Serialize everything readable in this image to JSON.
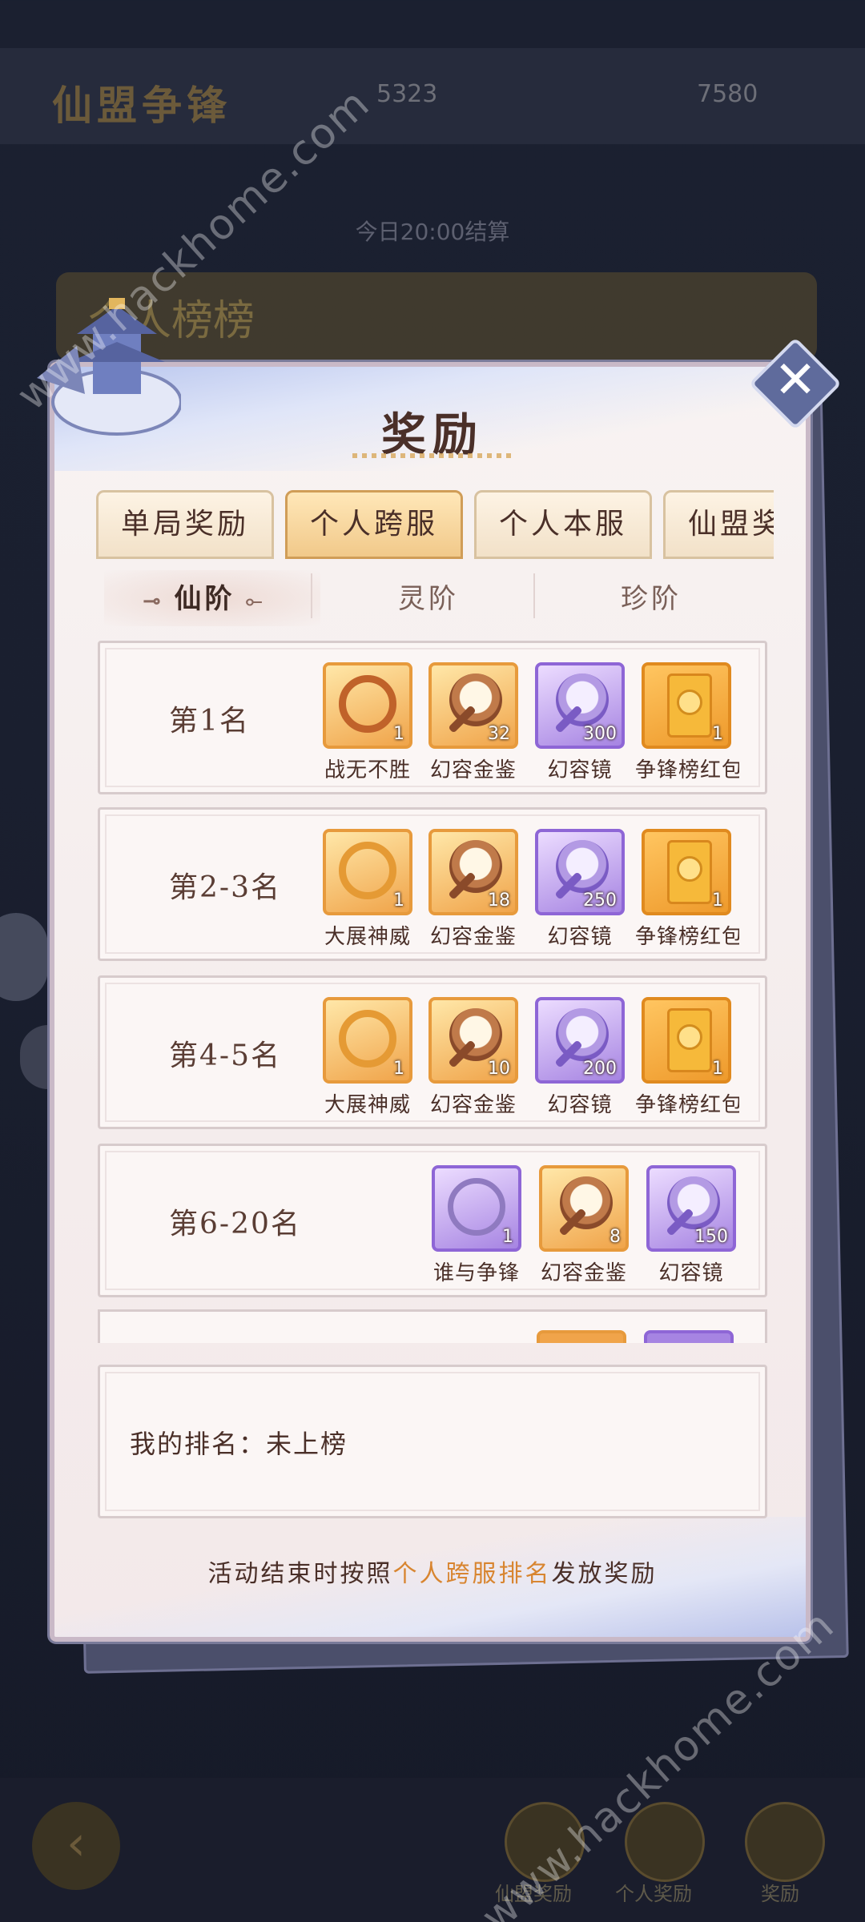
{
  "background": {
    "title": "仙盟争锋",
    "resource_1": "5323",
    "resource_2": "7580",
    "period": "今日20:00结算",
    "rank_title": "个人榜榜",
    "bottom_labels": [
      "仙盟奖励",
      "个人奖励",
      "奖励"
    ]
  },
  "watermarks": [
    "www.hackhome.com",
    "www.hackhome.com"
  ],
  "dialog": {
    "title": "奖励",
    "tabs": [
      {
        "label": "单局奖励",
        "active": false
      },
      {
        "label": "个人跨服",
        "active": true
      },
      {
        "label": "个人本服",
        "active": false
      },
      {
        "label": "仙盟奖励",
        "active": false
      }
    ],
    "subtabs": [
      {
        "label": "仙阶",
        "active": true
      },
      {
        "label": "灵阶",
        "active": false
      },
      {
        "label": "珍阶",
        "active": false
      }
    ],
    "rows": [
      {
        "rank": "第1名",
        "items": [
          {
            "name": "战无不胜",
            "count": "1",
            "icon": "bracelet-icon",
            "rarity": "orange"
          },
          {
            "name": "幻容金鉴",
            "count": "32",
            "icon": "mirror-icon",
            "rarity": "orange"
          },
          {
            "name": "幻容镜",
            "count": "300",
            "icon": "mirror-icon",
            "rarity": "purple"
          },
          {
            "name": "争锋榜红包",
            "count": "1",
            "icon": "red-envelope-icon",
            "rarity": "gold"
          }
        ]
      },
      {
        "rank": "第2-3名",
        "items": [
          {
            "name": "大展神威",
            "count": "1",
            "icon": "bracelet-icon",
            "rarity": "orange"
          },
          {
            "name": "幻容金鉴",
            "count": "18",
            "icon": "mirror-icon",
            "rarity": "orange"
          },
          {
            "name": "幻容镜",
            "count": "250",
            "icon": "mirror-icon",
            "rarity": "purple"
          },
          {
            "name": "争锋榜红包",
            "count": "1",
            "icon": "red-envelope-icon",
            "rarity": "gold"
          }
        ]
      },
      {
        "rank": "第4-5名",
        "items": [
          {
            "name": "大展神威",
            "count": "1",
            "icon": "bracelet-icon",
            "rarity": "orange"
          },
          {
            "name": "幻容金鉴",
            "count": "10",
            "icon": "mirror-icon",
            "rarity": "orange"
          },
          {
            "name": "幻容镜",
            "count": "200",
            "icon": "mirror-icon",
            "rarity": "purple"
          },
          {
            "name": "争锋榜红包",
            "count": "1",
            "icon": "red-envelope-icon",
            "rarity": "gold"
          }
        ]
      },
      {
        "rank": "第6-20名",
        "items": [
          {
            "name": "谁与争锋",
            "count": "1",
            "icon": "bracelet-icon",
            "rarity": "purple"
          },
          {
            "name": "幻容金鉴",
            "count": "8",
            "icon": "mirror-icon",
            "rarity": "orange"
          },
          {
            "name": "幻容镜",
            "count": "150",
            "icon": "mirror-icon",
            "rarity": "purple"
          }
        ]
      }
    ],
    "my_rank_label": "我的排名：",
    "my_rank_value": "未上榜",
    "footer_prefix": "活动结束时按照",
    "footer_highlight": "个人跨服排名",
    "footer_suffix": "发放奖励"
  },
  "colors": {
    "accent": "#d88530",
    "text": "#4a2f28",
    "frame": "#7a7b9a"
  }
}
